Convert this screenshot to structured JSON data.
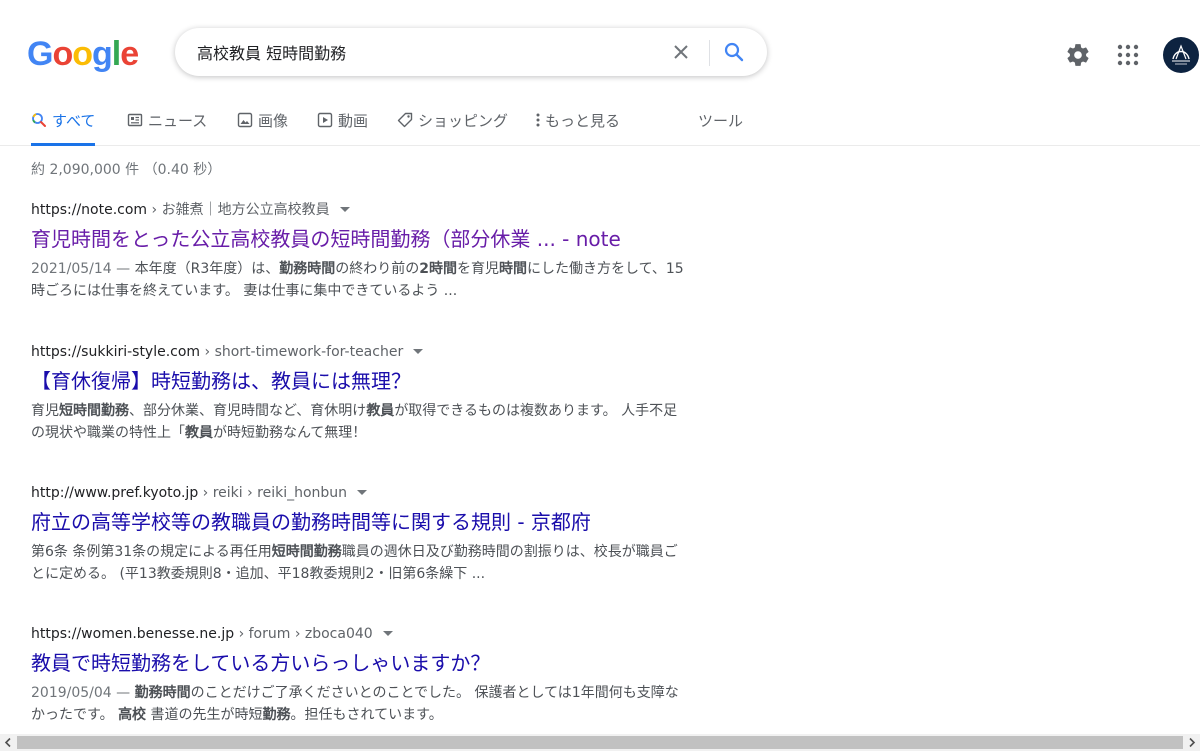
{
  "logo": {
    "letters": [
      "G",
      "o",
      "o",
      "g",
      "l",
      "e"
    ],
    "colors": [
      "#4285F4",
      "#EA4335",
      "#FBBC05",
      "#4285F4",
      "#34A853",
      "#EA4335"
    ]
  },
  "search": {
    "query": "高校教員 短時間勤務"
  },
  "header_icons": {
    "clear": "close-icon",
    "search": "search-icon",
    "settings": "gear-icon",
    "apps": "apps-grid-icon"
  },
  "tabs": [
    {
      "label": "すべて",
      "icon": "search-icon",
      "active": true
    },
    {
      "label": "ニュース",
      "icon": "news-icon"
    },
    {
      "label": "画像",
      "icon": "image-icon"
    },
    {
      "label": "動画",
      "icon": "video-icon"
    },
    {
      "label": "ショッピング",
      "icon": "tag-icon"
    },
    {
      "label": "もっと見る",
      "icon": "more-vert-icon"
    },
    {
      "label": "ツール"
    }
  ],
  "result_stats": "約 2,090,000 件 （0.40 秒）",
  "results": [
    {
      "domain": "https://note.com",
      "path": " › お雑煮｜地方公立高校教員",
      "title": "育児時間をとった公立高校教員の短時間勤務（部分休業 ... - note",
      "visited": true,
      "date": "2021/05/14 — ",
      "snippet": [
        {
          "t": "本年度（R3年度）は、"
        },
        {
          "t": "勤務時間",
          "b": true
        },
        {
          "t": "の終わり前の"
        },
        {
          "t": "2時間",
          "b": true
        },
        {
          "t": "を育児"
        },
        {
          "t": "時間",
          "b": true
        },
        {
          "t": "にした働き方をして、15時ごろには仕事を終えています。 妻は仕事に集中できているよう ..."
        }
      ]
    },
    {
      "domain": "https://sukkiri-style.com",
      "path": " › short-timework-for-teacher",
      "title": "【育休復帰】時短勤務は、教員には無理？",
      "visited": false,
      "date": "",
      "snippet": [
        {
          "t": "育児"
        },
        {
          "t": "短時間勤務",
          "b": true
        },
        {
          "t": "、部分休業、育児時間など、育休明け"
        },
        {
          "t": "教員",
          "b": true
        },
        {
          "t": "が取得できるものは複数あります。 人手不足の現状や職業の特性上「"
        },
        {
          "t": "教員",
          "b": true
        },
        {
          "t": "が時短勤務なんて無理！"
        }
      ]
    },
    {
      "domain": "http://www.pref.kyoto.jp",
      "path": " › reiki › reiki_honbun",
      "title": "府立の高等学校等の教職員の勤務時間等に関する規則 - 京都府",
      "visited": false,
      "date": "",
      "snippet": [
        {
          "t": "第6条 条例第31条の規定による再任用"
        },
        {
          "t": "短時間勤務",
          "b": true
        },
        {
          "t": "職員の週休日及び勤務時間の割振りは、校長が職員ごとに定める。 (平13教委規則8・追加、平18教委規則2・旧第6条繰下 ..."
        }
      ]
    },
    {
      "domain": "https://women.benesse.ne.jp",
      "path": " › forum › zboca040",
      "title": "教員で時短勤務をしている方いらっしゃいますか？",
      "visited": false,
      "date": "2019/05/04 — ",
      "snippet": [
        {
          "t": "勤務時間",
          "b": true
        },
        {
          "t": "のことだけご了承くださいとのことでした。 保護者としては1年間何も支障なかったです。 "
        },
        {
          "t": "高校",
          "b": true
        },
        {
          "t": " 書道の先生が時短"
        },
        {
          "t": "勤務",
          "b": true
        },
        {
          "t": "。担任もされています。"
        }
      ]
    }
  ]
}
